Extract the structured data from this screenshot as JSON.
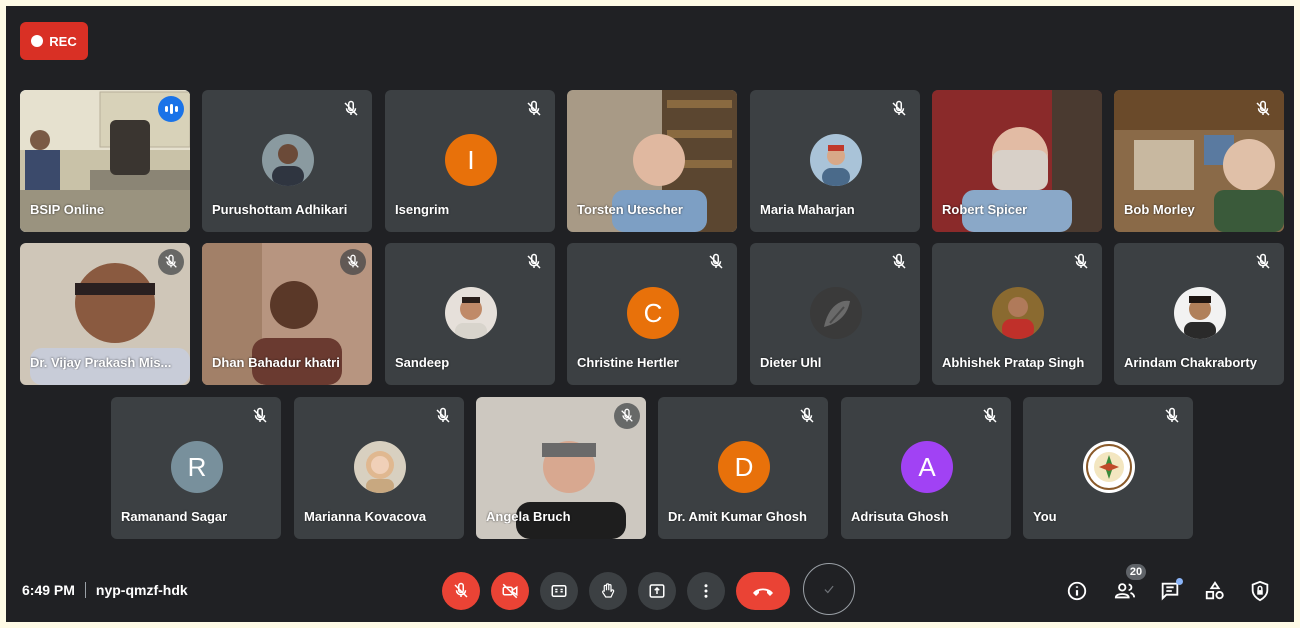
{
  "recording": {
    "label": "REC"
  },
  "meeting": {
    "time": "6:49 PM",
    "code": "nyp-qmzf-hdk",
    "participant_count": "20"
  },
  "participants": [
    {
      "name": "BSIP Online"
    },
    {
      "name": "Purushottam Adhikari"
    },
    {
      "name": "Isengrim",
      "initial": "I",
      "color": "#e8710a"
    },
    {
      "name": "Torsten Utescher"
    },
    {
      "name": "Maria Maharjan"
    },
    {
      "name": "Robert Spicer"
    },
    {
      "name": "Bob Morley"
    },
    {
      "name": "Dr. Vijay Prakash Mis..."
    },
    {
      "name": "Dhan Bahadur khatri"
    },
    {
      "name": "Sandeep"
    },
    {
      "name": "Christine Hertler",
      "initial": "C",
      "color": "#e8710a"
    },
    {
      "name": "Dieter Uhl"
    },
    {
      "name": "Abhishek Pratap Singh"
    },
    {
      "name": "Arindam Chakraborty"
    },
    {
      "name": "Ramanand Sagar",
      "initial": "R",
      "color": "#78909c"
    },
    {
      "name": "Marianna Kovacova"
    },
    {
      "name": "Angela Bruch"
    },
    {
      "name": "Dr. Amit Kumar Ghosh",
      "initial": "D",
      "color": "#e8710a"
    },
    {
      "name": "Adrisuta Ghosh",
      "initial": "A",
      "color": "#a142f4"
    },
    {
      "name": "You"
    }
  ]
}
